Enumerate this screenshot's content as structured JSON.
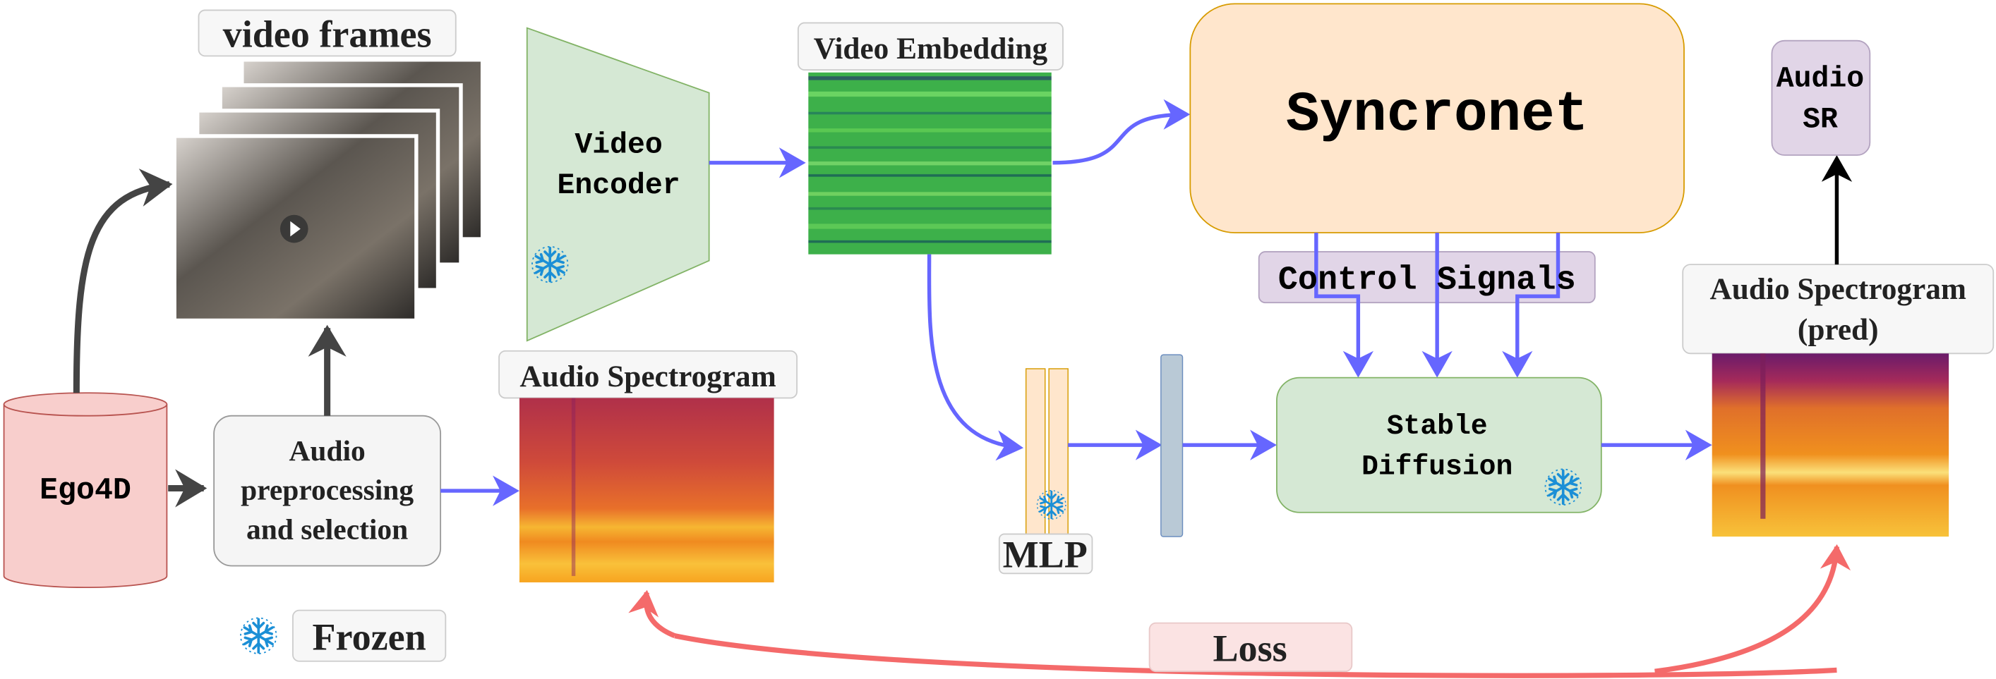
{
  "labels": {
    "video_frames": "video frames",
    "video_encoder": [
      "Video",
      "Encoder"
    ],
    "video_embedding": "Video Embedding",
    "syncronet": "Syncronet",
    "control_signals": "Control Signals",
    "stable_diffusion": [
      "Stable",
      "Diffusion"
    ],
    "mlp": "MLP",
    "audio_spectrogram": "Audio Spectrogram",
    "audio_spectrogram_pred": [
      "Audio Spectrogram",
      "(pred)"
    ],
    "audio_sr": [
      "Audio",
      "SR"
    ],
    "ego4d": "Ego4D",
    "preprocessing": [
      "Audio",
      "preprocessing",
      "and selection"
    ],
    "frozen": "Frozen",
    "loss": "Loss"
  },
  "colors": {
    "flow_arrow": "#6666ff",
    "data_arrow": "#444444",
    "loss_arrow": "#f46a6a",
    "syncronet_fill": "#ffe6cc",
    "green_fill": "#d5e8d4",
    "purple_fill": "#e1d5e7",
    "ego4d_fill": "#f8cecc",
    "snowflake": "#1b8fd6"
  },
  "icons": [
    "snowflake-icon",
    "play-icon"
  ]
}
